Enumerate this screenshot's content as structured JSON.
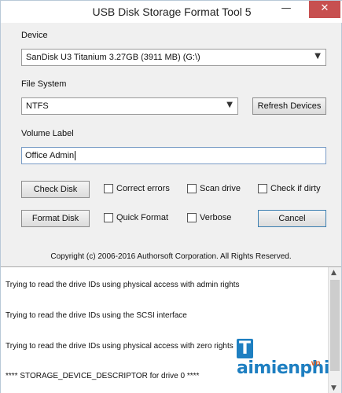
{
  "window": {
    "title": "USB Disk Storage Format Tool 5",
    "minimize_glyph": "—",
    "close_glyph": "✕"
  },
  "device": {
    "label": "Device",
    "selected": "SanDisk U3 Titanium 3.27GB (3911 MB)  (G:\\)"
  },
  "file_system": {
    "label": "File System",
    "selected": "NTFS"
  },
  "refresh_button": "Refresh Devices",
  "volume_label": {
    "label": "Volume Label",
    "value": "Office Admin"
  },
  "check_disk_button": "Check Disk",
  "format_disk_button": "Format Disk",
  "cancel_button": "Cancel",
  "options": {
    "correct_errors": "Correct errors",
    "scan_drive": "Scan drive",
    "check_if_dirty": "Check if dirty",
    "quick_format": "Quick Format",
    "verbose": "Verbose"
  },
  "copyright": "Copyright (c) 2006-2016 Authorsoft Corporation. All Rights Reserved.",
  "log": [
    "Trying to read the drive IDs using physical access with admin rights",
    "Trying to read the drive IDs using the SCSI interface",
    "Trying to read the drive IDs using physical access with zero rights",
    "**** STORAGE_DEVICE_DESCRIPTOR for drive 0 ****"
  ],
  "icons": {
    "dropdown_arrow": "chevron-down-icon",
    "scroll_up": "arrow-up-icon",
    "scroll_down": "arrow-down-icon"
  },
  "watermark": {
    "brand": "aimienphi",
    "brand_initial": "T",
    "suffix": ".vn"
  },
  "colors": {
    "title_bar": "#ffffff",
    "close_button": "#c75050",
    "window_bg": "#f0f0f0",
    "watermark_blue": "#1e7fc1",
    "watermark_orange": "#e05a1b"
  }
}
